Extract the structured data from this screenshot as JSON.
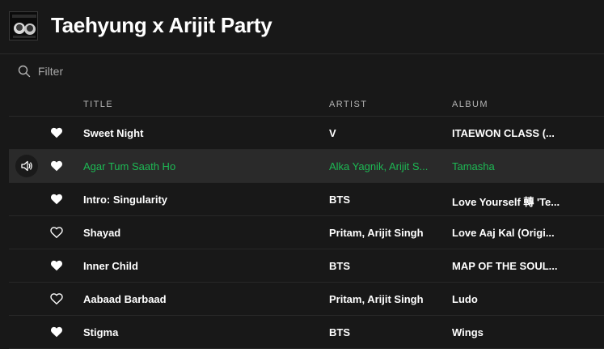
{
  "playlist": {
    "title": "Taehyung x Arijit Party"
  },
  "filter": {
    "placeholder": "Filter",
    "icon": "search-icon"
  },
  "columns": {
    "title": "TITLE",
    "artist": "ARTIST",
    "album": "ALBUM"
  },
  "tracks": [
    {
      "title": "Sweet Night",
      "artist": "V",
      "album": "ITAEWON CLASS (...",
      "liked": true
    },
    {
      "title": "Agar Tum Saath Ho",
      "artist": "Alka Yagnik, Arijit S...",
      "album": "Tamasha",
      "liked": true,
      "playing": true
    },
    {
      "title": "Intro: Singularity",
      "artist": "BTS",
      "album": "Love Yourself 轉 'Te...",
      "liked": true
    },
    {
      "title": "Shayad",
      "artist": "Pritam, Arijit Singh",
      "album": "Love Aaj Kal (Origi...",
      "liked": false
    },
    {
      "title": "Inner Child",
      "artist": "BTS",
      "album": "MAP OF THE SOUL...",
      "liked": true
    },
    {
      "title": "Aabaad Barbaad",
      "artist": "Pritam, Arijit Singh",
      "album": "Ludo",
      "liked": false
    },
    {
      "title": "Stigma",
      "artist": "BTS",
      "album": "Wings",
      "liked": true
    }
  ],
  "colors": {
    "background": "#181818",
    "accent": "#1db954",
    "row_active": "#2a2a2a",
    "muted_text": "#b3b3b3"
  }
}
